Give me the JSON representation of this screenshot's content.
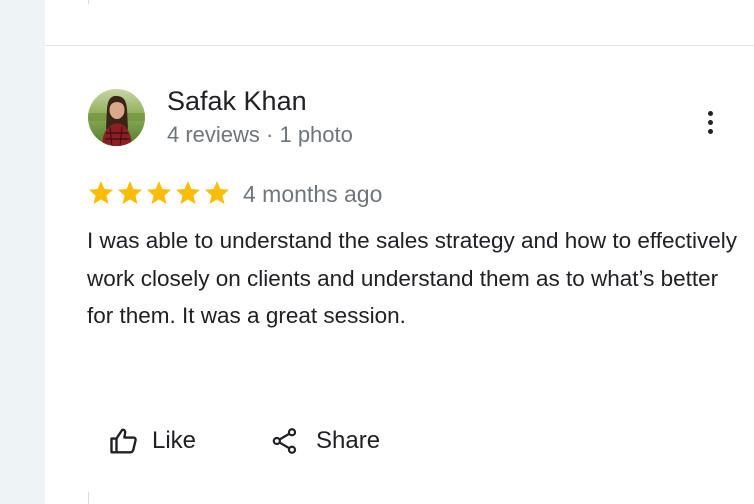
{
  "review": {
    "author": {
      "name": "Safak Khan",
      "meta": "4 reviews · 1 photo"
    },
    "rating": 5,
    "max_rating": 5,
    "time_ago": "4 months ago",
    "text": "I was able to understand the sales strategy and how to effectively work closely on clients and understand them as to what’s better for them. It was a great session.",
    "actions": {
      "like_label": "Like",
      "share_label": "Share"
    }
  },
  "colors": {
    "star": "#fbbc04",
    "text_primary": "#202124",
    "text_secondary": "#70757a",
    "side_strip": "#eef3f6"
  },
  "icons": {
    "menu": "more-vert-icon",
    "like": "thumb-up-icon",
    "share": "share-icon"
  }
}
